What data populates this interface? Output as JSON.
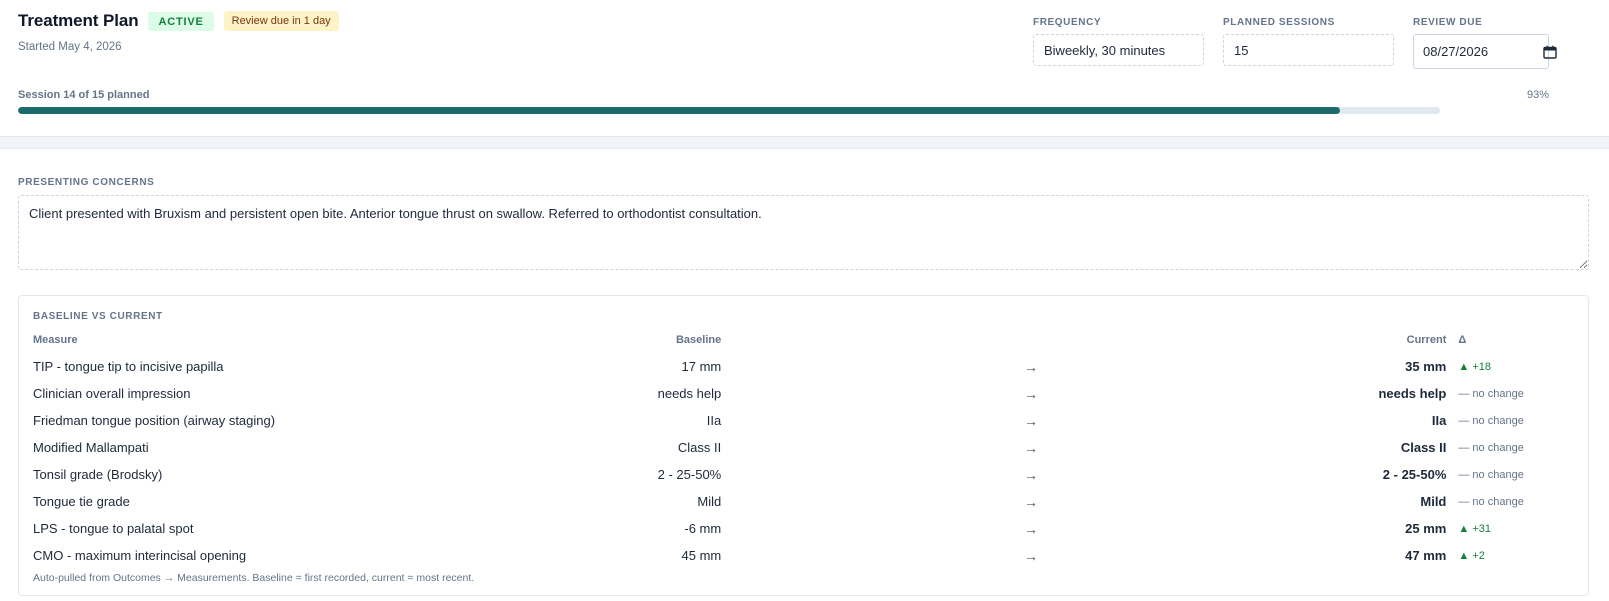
{
  "header": {
    "title": "Treatment Plan",
    "status_badge": "ACTIVE",
    "review_badge": "Review due in 1 day",
    "started": "Started May 4, 2026",
    "frequency": {
      "label": "FREQUENCY",
      "value": "Biweekly, 30 minutes"
    },
    "planned_sessions": {
      "label": "PLANNED SESSIONS",
      "value": "15"
    },
    "review_due": {
      "label": "REVIEW DUE",
      "value": "2026-08-27"
    }
  },
  "progress": {
    "label": "Session 14 of 15 planned",
    "percent_text": "93%",
    "fraction": 0.93,
    "color": "#1e6b6e"
  },
  "concerns": {
    "label": "PRESENTING CONCERNS",
    "text": "Client presented with Bruxism and persistent open bite. Anterior tongue thrust on swallow. Referred to orthodontist consultation."
  },
  "comparison": {
    "label": "BASELINE VS CURRENT",
    "columns": {
      "measure": "Measure",
      "baseline": "Baseline",
      "current": "Current",
      "delta": "Δ"
    },
    "arrow": "→",
    "rows": [
      {
        "measure": "TIP - tongue tip to incisive papilla",
        "baseline": "17 mm",
        "current": "35 mm",
        "delta": "▲ +18",
        "trend": "up"
      },
      {
        "measure": "Clinician overall impression",
        "baseline": "needs help",
        "current": "needs help",
        "delta": "— no change",
        "trend": "none"
      },
      {
        "measure": "Friedman tongue position (airway staging)",
        "baseline": "IIa",
        "current": "IIa",
        "delta": "— no change",
        "trend": "none"
      },
      {
        "measure": "Modified Mallampati",
        "baseline": "Class II",
        "current": "Class II",
        "delta": "— no change",
        "trend": "none"
      },
      {
        "measure": "Tonsil grade (Brodsky)",
        "baseline": "2 - 25-50%",
        "current": "2 - 25-50%",
        "delta": "— no change",
        "trend": "none"
      },
      {
        "measure": "Tongue tie grade",
        "baseline": "Mild",
        "current": "Mild",
        "delta": "— no change",
        "trend": "none"
      },
      {
        "measure": "LPS - tongue to palatal spot",
        "baseline": "-6 mm",
        "current": "25 mm",
        "delta": "▲ +31",
        "trend": "up"
      },
      {
        "measure": "CMO - maximum interincisal opening",
        "baseline": "45 mm",
        "current": "47 mm",
        "delta": "▲ +2",
        "trend": "up"
      }
    ],
    "footnote": "Auto-pulled from Outcomes → Measurements. Baseline = first recorded, current = most recent."
  }
}
